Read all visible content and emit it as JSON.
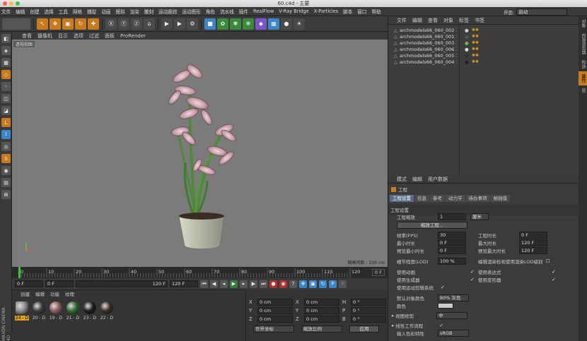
{
  "window": {
    "title": "60.c4d - 主要"
  },
  "menubar": {
    "items": [
      "文件",
      "编辑",
      "创建",
      "选择",
      "工具",
      "网格",
      "捕捉",
      "动画",
      "模拟",
      "渲染",
      "雕刻",
      "运动跟踪",
      "运动图形",
      "角色",
      "流水线",
      "插件",
      "RealFlow",
      "V-Ray Bridge",
      "X-Particles",
      "脚本",
      "窗口",
      "帮助"
    ],
    "layout_label": "界面:",
    "layout_value": "启动"
  },
  "viewport": {
    "menu": [
      "查看",
      "摄像机",
      "显示",
      "选项",
      "过滤",
      "面板",
      "ProRender"
    ],
    "label": "透视视图",
    "grid_spacing": "网格间距 : 100 cm"
  },
  "timeline": {
    "ticks": [
      "0",
      "10",
      "20",
      "30",
      "40",
      "50",
      "60",
      "70",
      "80",
      "90",
      "100",
      "110",
      "120"
    ],
    "frame_badge": "0 F"
  },
  "transport": {
    "start": "0 F",
    "min": "0 F",
    "max": "120 F",
    "end": "120 F"
  },
  "materials": {
    "menu": [
      "创建",
      "编辑",
      "功能",
      "纹理"
    ],
    "swatches": [
      {
        "label": "24 - D",
        "color": "#8c8c8c"
      },
      {
        "label": "20 - D",
        "color": "#3a3a3a"
      },
      {
        "label": "19 - D",
        "color": "#8a5a5a"
      },
      {
        "label": "21 - D",
        "color": "#2f6a2f"
      },
      {
        "label": "23 - D",
        "color": "#1c1c1c"
      },
      {
        "label": "22 - D",
        "color": "#3b2a22"
      }
    ]
  },
  "coords": {
    "rows": [
      [
        "X",
        "0 cm",
        "X",
        "0 cm",
        "H",
        "0 °"
      ],
      [
        "Y",
        "0 cm",
        "Y",
        "0 cm",
        "P",
        "0 °"
      ],
      [
        "Z",
        "0 cm",
        "Z",
        "0 cm",
        "B",
        "0 °"
      ]
    ],
    "mode1": "世界坐标",
    "mode2": "缩放比例",
    "apply": "应用"
  },
  "objects": {
    "menu": [
      "文件",
      "编辑",
      "查看",
      "对象",
      "标签",
      "书签"
    ],
    "items": [
      "archmodels66_060_002",
      "archmodels66_060_001",
      "archmodels66_060_003",
      "archmodels66_060_006",
      "archmodels66_060_005",
      "archmodels66_060_004"
    ]
  },
  "attributes": {
    "menu": [
      "模式",
      "编辑",
      "用户数据"
    ],
    "title": "工程",
    "tabs": [
      "工程设置",
      "信息",
      "参考",
      "动力学",
      "待办事项",
      "帧插值"
    ],
    "section": "工程设置",
    "scale_label": "工程缩放",
    "scale_value": "1",
    "scale_unit": "厘米",
    "scale_btn": "缩放工程...",
    "fps_label": "帧率(FPS)",
    "fps": "30",
    "proj_time_label": "工程时长",
    "proj_time": "0 F",
    "min_time_label": "最小时长",
    "min_time": "0 F",
    "max_time_label": "最大时长",
    "max_time": "120 F",
    "prev_min_label": "预览最小时长",
    "prev_min": "0 F",
    "prev_max_label": "预览最大时长",
    "prev_max": "120 F",
    "lod_label": "细节程度(LOD)",
    "lod": "100 %",
    "lod_render": "编辑渲染检视使用渲染LOD级别",
    "anim": "使用动画",
    "expr": "使用表达式",
    "gen": "使用生成器",
    "deform": "使用变形器",
    "motion": "使用运动剪辑系统",
    "color_label": "默认对象颜色",
    "color_value": "80% 灰色",
    "color2": "颜色",
    "view_label": "视图修剪",
    "view_value": "中",
    "linear_label": "线性工作流程",
    "input_label": "输入色彩特性",
    "input_value": "sRGB"
  },
  "sidetabs": [
    "对象",
    "内容浏览器",
    "构造",
    "属性",
    "层"
  ]
}
